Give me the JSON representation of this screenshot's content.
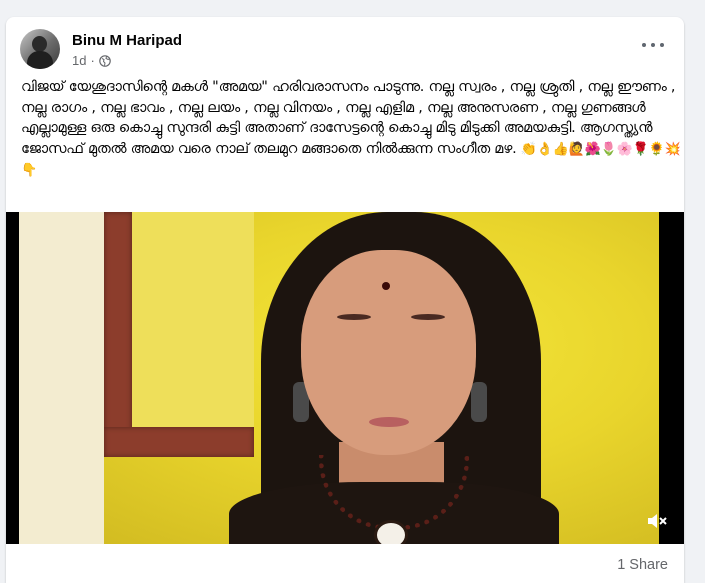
{
  "post": {
    "author": "Binu M Haripad",
    "timestamp": "1d",
    "privacy_icon": "globe-icon",
    "menu_icon": "more-options-icon",
    "text": "വിജയ് യേശുദാസിന്റെ മകൾ \"അമയ\" ഹരിവരാസനം പാടുന്നു. നല്ല സ്വരം , നല്ല ശ്രുതി , നല്ല ഈണം , നല്ല രാഗം , നല്ല ഭാവം , നല്ല ലയം , നല്ല വിനയം , നല്ല എളിമ , നല്ല അനുസരണ , നല്ല ഗുണങ്ങൾ എല്ലാമുള്ള ഒരു കൊച്ചു സുന്ദരി കുട്ടി അതാണ് ദാസേട്ടന്റെ കൊച്ചു മിടു മിടുക്കി അമയകുട്ടി. ആഗസ്ത്യൻ ജോസഫ് മുതൽ അമയ വരെ നാല് തലമുറ മങ്ങാതെ നിൽക്കുന്ന സംഗീത മഴ.",
    "emojis": "👏👌👍🙋🌺🌷🌸🌹🌻💥👇"
  },
  "video": {
    "volume_icon": "volume-muted-icon"
  },
  "footer": {
    "shares": "1 Share"
  }
}
